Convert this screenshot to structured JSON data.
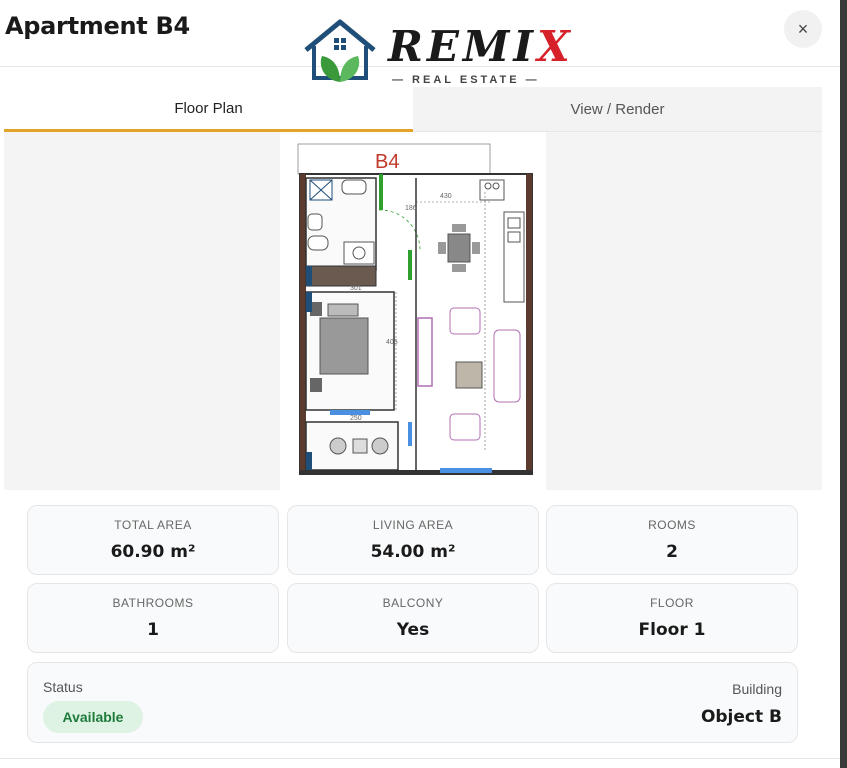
{
  "header": {
    "title": "Apartment B4",
    "close_label": "×"
  },
  "logo": {
    "word_main": "REMI",
    "word_x": "X",
    "subtitle": "— REAL ESTATE —"
  },
  "tabs": [
    {
      "label": "Floor Plan",
      "active": true
    },
    {
      "label": "View / Render",
      "active": false
    }
  ],
  "floor_plan": {
    "unit_label": "B4",
    "dimension_labels": [
      "430",
      "186",
      "301",
      "405",
      "250"
    ]
  },
  "stats": [
    {
      "label": "TOTAL AREA",
      "value": "60.90 m²"
    },
    {
      "label": "LIVING AREA",
      "value": "54.00 m²"
    },
    {
      "label": "ROOMS",
      "value": "2"
    },
    {
      "label": "BATHROOMS",
      "value": "1"
    },
    {
      "label": "BALCONY",
      "value": "Yes"
    },
    {
      "label": "FLOOR",
      "value": "Floor 1"
    }
  ],
  "status": {
    "label": "Status",
    "value": "Available",
    "color": "#1e7a3a"
  },
  "building": {
    "label": "Building",
    "value": "Object B"
  },
  "colors": {
    "accent": "#e3a329",
    "logo_red": "#d6212a",
    "logo_green": "#3a9a3a",
    "logo_blue": "#1f4e79"
  }
}
